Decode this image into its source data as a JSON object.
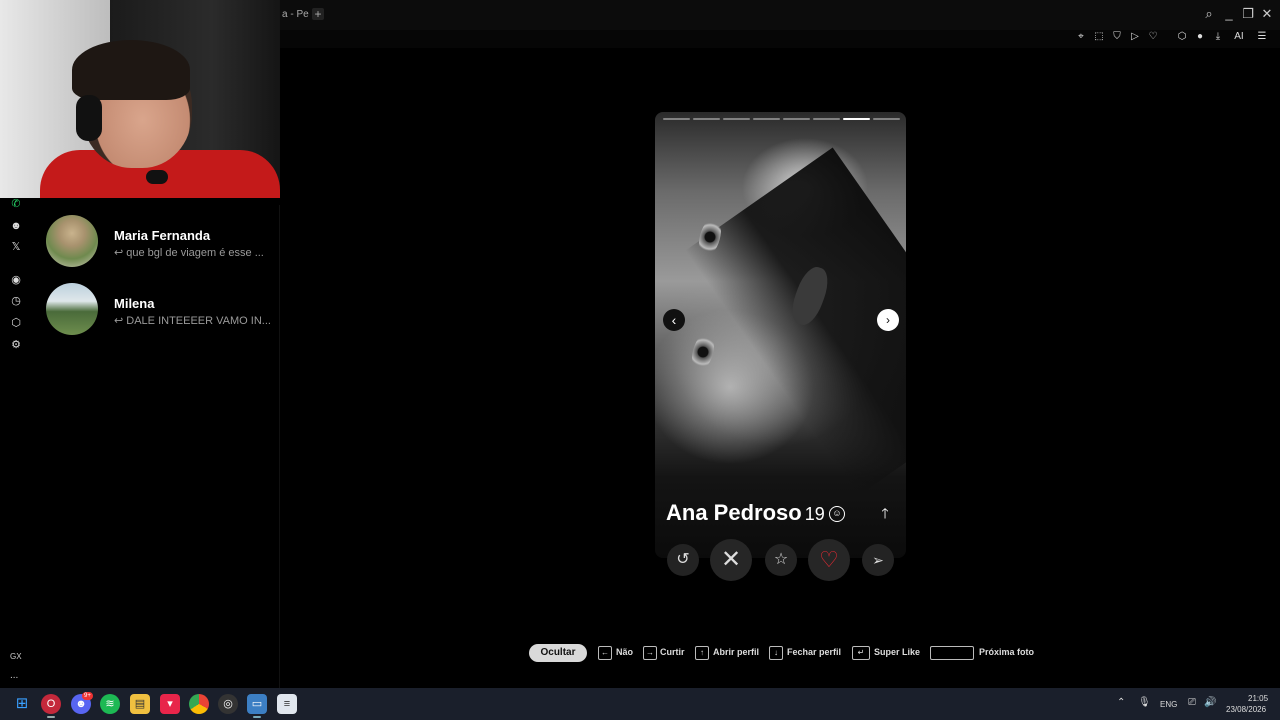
{
  "browser": {
    "tab_title": "a - Pe",
    "tab_add": "+",
    "window_controls": [
      "search-icon",
      "minimize-icon",
      "restore-icon",
      "close-icon"
    ],
    "toolbar_ai_label": "AI"
  },
  "sidebar": {
    "chats": [
      {
        "name": "Maria Fernanda",
        "preview": "↩ que bgl de viagem é esse ..."
      },
      {
        "name": "Milena",
        "preview": "↩ DALE INTEEEER VAMO IN..."
      }
    ]
  },
  "rail": {
    "gx_label": "GX",
    "more": "..."
  },
  "card": {
    "name": "Ana Pedroso",
    "age": "19",
    "photo_count": 8,
    "active_photo_index": 7
  },
  "actions": [
    "rewind-icon",
    "nope-icon",
    "super-like-icon",
    "like-icon",
    "boost-icon"
  ],
  "shortcuts": {
    "hide_label": "Ocultar",
    "items": [
      {
        "key": "←",
        "label": "Não"
      },
      {
        "key": "→",
        "label": "Curtir"
      },
      {
        "key": "↑",
        "label": "Abrir perfil"
      },
      {
        "key": "↓",
        "label": "Fechar perfil"
      },
      {
        "key": "↵",
        "label": "Super Like"
      },
      {
        "key": "",
        "label": "Próxima foto"
      }
    ]
  },
  "taskbar": {
    "discord_badge": "9+",
    "language": "ENG",
    "time": "21:05",
    "date": "23/08/2026"
  },
  "colors": {
    "like": "#e02a33",
    "taskbar": "#1a1f2b"
  }
}
